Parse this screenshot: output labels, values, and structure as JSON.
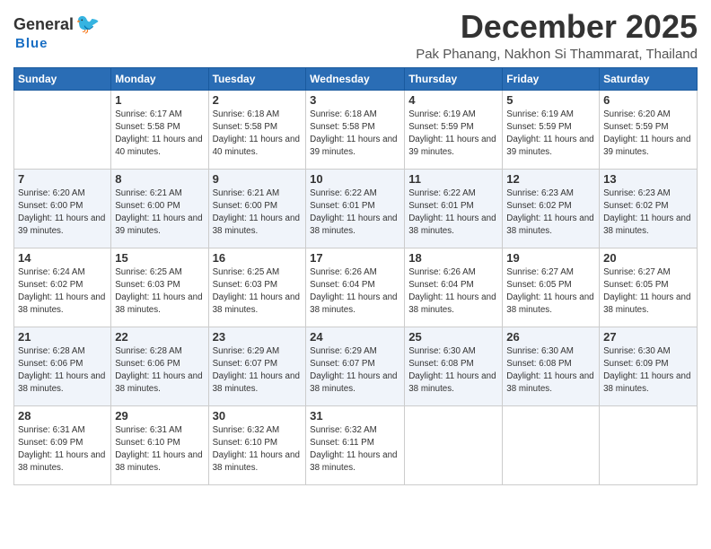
{
  "logo": {
    "general": "General",
    "blue": "Blue"
  },
  "title": "December 2025",
  "location": "Pak Phanang, Nakhon Si Thammarat, Thailand",
  "days_header": [
    "Sunday",
    "Monday",
    "Tuesday",
    "Wednesday",
    "Thursday",
    "Friday",
    "Saturday"
  ],
  "weeks": [
    [
      {
        "num": "",
        "sunrise": "",
        "sunset": "",
        "daylight": ""
      },
      {
        "num": "1",
        "sunrise": "Sunrise: 6:17 AM",
        "sunset": "Sunset: 5:58 PM",
        "daylight": "Daylight: 11 hours and 40 minutes."
      },
      {
        "num": "2",
        "sunrise": "Sunrise: 6:18 AM",
        "sunset": "Sunset: 5:58 PM",
        "daylight": "Daylight: 11 hours and 40 minutes."
      },
      {
        "num": "3",
        "sunrise": "Sunrise: 6:18 AM",
        "sunset": "Sunset: 5:58 PM",
        "daylight": "Daylight: 11 hours and 39 minutes."
      },
      {
        "num": "4",
        "sunrise": "Sunrise: 6:19 AM",
        "sunset": "Sunset: 5:59 PM",
        "daylight": "Daylight: 11 hours and 39 minutes."
      },
      {
        "num": "5",
        "sunrise": "Sunrise: 6:19 AM",
        "sunset": "Sunset: 5:59 PM",
        "daylight": "Daylight: 11 hours and 39 minutes."
      },
      {
        "num": "6",
        "sunrise": "Sunrise: 6:20 AM",
        "sunset": "Sunset: 5:59 PM",
        "daylight": "Daylight: 11 hours and 39 minutes."
      }
    ],
    [
      {
        "num": "7",
        "sunrise": "Sunrise: 6:20 AM",
        "sunset": "Sunset: 6:00 PM",
        "daylight": "Daylight: 11 hours and 39 minutes."
      },
      {
        "num": "8",
        "sunrise": "Sunrise: 6:21 AM",
        "sunset": "Sunset: 6:00 PM",
        "daylight": "Daylight: 11 hours and 39 minutes."
      },
      {
        "num": "9",
        "sunrise": "Sunrise: 6:21 AM",
        "sunset": "Sunset: 6:00 PM",
        "daylight": "Daylight: 11 hours and 38 minutes."
      },
      {
        "num": "10",
        "sunrise": "Sunrise: 6:22 AM",
        "sunset": "Sunset: 6:01 PM",
        "daylight": "Daylight: 11 hours and 38 minutes."
      },
      {
        "num": "11",
        "sunrise": "Sunrise: 6:22 AM",
        "sunset": "Sunset: 6:01 PM",
        "daylight": "Daylight: 11 hours and 38 minutes."
      },
      {
        "num": "12",
        "sunrise": "Sunrise: 6:23 AM",
        "sunset": "Sunset: 6:02 PM",
        "daylight": "Daylight: 11 hours and 38 minutes."
      },
      {
        "num": "13",
        "sunrise": "Sunrise: 6:23 AM",
        "sunset": "Sunset: 6:02 PM",
        "daylight": "Daylight: 11 hours and 38 minutes."
      }
    ],
    [
      {
        "num": "14",
        "sunrise": "Sunrise: 6:24 AM",
        "sunset": "Sunset: 6:02 PM",
        "daylight": "Daylight: 11 hours and 38 minutes."
      },
      {
        "num": "15",
        "sunrise": "Sunrise: 6:25 AM",
        "sunset": "Sunset: 6:03 PM",
        "daylight": "Daylight: 11 hours and 38 minutes."
      },
      {
        "num": "16",
        "sunrise": "Sunrise: 6:25 AM",
        "sunset": "Sunset: 6:03 PM",
        "daylight": "Daylight: 11 hours and 38 minutes."
      },
      {
        "num": "17",
        "sunrise": "Sunrise: 6:26 AM",
        "sunset": "Sunset: 6:04 PM",
        "daylight": "Daylight: 11 hours and 38 minutes."
      },
      {
        "num": "18",
        "sunrise": "Sunrise: 6:26 AM",
        "sunset": "Sunset: 6:04 PM",
        "daylight": "Daylight: 11 hours and 38 minutes."
      },
      {
        "num": "19",
        "sunrise": "Sunrise: 6:27 AM",
        "sunset": "Sunset: 6:05 PM",
        "daylight": "Daylight: 11 hours and 38 minutes."
      },
      {
        "num": "20",
        "sunrise": "Sunrise: 6:27 AM",
        "sunset": "Sunset: 6:05 PM",
        "daylight": "Daylight: 11 hours and 38 minutes."
      }
    ],
    [
      {
        "num": "21",
        "sunrise": "Sunrise: 6:28 AM",
        "sunset": "Sunset: 6:06 PM",
        "daylight": "Daylight: 11 hours and 38 minutes."
      },
      {
        "num": "22",
        "sunrise": "Sunrise: 6:28 AM",
        "sunset": "Sunset: 6:06 PM",
        "daylight": "Daylight: 11 hours and 38 minutes."
      },
      {
        "num": "23",
        "sunrise": "Sunrise: 6:29 AM",
        "sunset": "Sunset: 6:07 PM",
        "daylight": "Daylight: 11 hours and 38 minutes."
      },
      {
        "num": "24",
        "sunrise": "Sunrise: 6:29 AM",
        "sunset": "Sunset: 6:07 PM",
        "daylight": "Daylight: 11 hours and 38 minutes."
      },
      {
        "num": "25",
        "sunrise": "Sunrise: 6:30 AM",
        "sunset": "Sunset: 6:08 PM",
        "daylight": "Daylight: 11 hours and 38 minutes."
      },
      {
        "num": "26",
        "sunrise": "Sunrise: 6:30 AM",
        "sunset": "Sunset: 6:08 PM",
        "daylight": "Daylight: 11 hours and 38 minutes."
      },
      {
        "num": "27",
        "sunrise": "Sunrise: 6:30 AM",
        "sunset": "Sunset: 6:09 PM",
        "daylight": "Daylight: 11 hours and 38 minutes."
      }
    ],
    [
      {
        "num": "28",
        "sunrise": "Sunrise: 6:31 AM",
        "sunset": "Sunset: 6:09 PM",
        "daylight": "Daylight: 11 hours and 38 minutes."
      },
      {
        "num": "29",
        "sunrise": "Sunrise: 6:31 AM",
        "sunset": "Sunset: 6:10 PM",
        "daylight": "Daylight: 11 hours and 38 minutes."
      },
      {
        "num": "30",
        "sunrise": "Sunrise: 6:32 AM",
        "sunset": "Sunset: 6:10 PM",
        "daylight": "Daylight: 11 hours and 38 minutes."
      },
      {
        "num": "31",
        "sunrise": "Sunrise: 6:32 AM",
        "sunset": "Sunset: 6:11 PM",
        "daylight": "Daylight: 11 hours and 38 minutes."
      },
      {
        "num": "",
        "sunrise": "",
        "sunset": "",
        "daylight": ""
      },
      {
        "num": "",
        "sunrise": "",
        "sunset": "",
        "daylight": ""
      },
      {
        "num": "",
        "sunrise": "",
        "sunset": "",
        "daylight": ""
      }
    ]
  ]
}
